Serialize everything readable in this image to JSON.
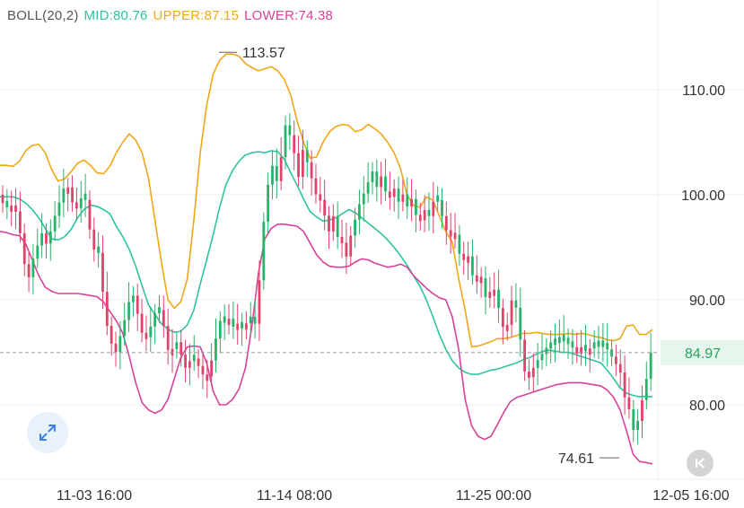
{
  "legend": {
    "title": "BOLL(20,2)",
    "mid": "MID:80.76",
    "upper": "UPPER:87.15",
    "lower": "LOWER:74.38"
  },
  "colors": {
    "mid": "#2ec4a0",
    "upper": "#f0a818",
    "lower": "#d8439a",
    "up_candle": "#27b36a",
    "down_candle": "#e0436a",
    "grid": "#eeeeee",
    "axis_text": "#333333",
    "price_tag_bg": "#e7f6ec",
    "price_tag_text": "#27a35e"
  },
  "icons": {
    "expand": "expand-diagonal-arrows-icon",
    "back": "skip-back-icon"
  },
  "chart_data": {
    "type": "candlestick",
    "indicator": "BOLL(20,2)",
    "ylim": [
      74,
      117
    ],
    "yticks": [
      "110.00",
      "100.00",
      "90.00",
      "80.00"
    ],
    "xlabels": [
      "11-03 16:00",
      "11-14 08:00",
      "11-25 00:00",
      "12-05 16:00"
    ],
    "current_price": "84.97",
    "annotations": {
      "high": "113.57",
      "low": "74.61"
    },
    "bands": {
      "upper": [
        102.8,
        102.8,
        102.7,
        103.2,
        104.2,
        104.7,
        104.8,
        104.0,
        102.4,
        101.3,
        101.5,
        102.2,
        103.0,
        103.3,
        102.8,
        102.1,
        102.0,
        102.7,
        104.0,
        105.0,
        105.8,
        105.2,
        104.0,
        101.5,
        97.5,
        93.5,
        90.0,
        89.2,
        89.8,
        92.0,
        97.5,
        104.0,
        108.5,
        111.5,
        112.8,
        113.4,
        113.4,
        113.2,
        112.5,
        112.1,
        111.8,
        112.0,
        112.2,
        111.8,
        111.0,
        109.5,
        107.0,
        105.0,
        103.5,
        103.6,
        105.0,
        106.0,
        106.5,
        106.7,
        106.6,
        106.0,
        106.2,
        106.7,
        106.3,
        105.8,
        105.0,
        104.0,
        102.5,
        100.0,
        99.0,
        98.8,
        99.8,
        99.5,
        98.0,
        96.5,
        95.5,
        92.0,
        89.0,
        85.5,
        85.6,
        85.8,
        86.0,
        86.3,
        86.3,
        86.4,
        86.6,
        86.8,
        86.8,
        86.9,
        86.8,
        86.7,
        86.7,
        86.7,
        86.8,
        86.7,
        86.8,
        86.7,
        86.5,
        86.4,
        86.2,
        86.1,
        86.3,
        87.5,
        87.6,
        86.7,
        86.7,
        87.15
      ],
      "mid": [
        99.8,
        99.8,
        99.8,
        99.6,
        99.2,
        98.6,
        97.8,
        96.8,
        95.8,
        95.7,
        96.0,
        96.7,
        97.8,
        98.6,
        99.0,
        98.9,
        98.6,
        98.2,
        97.0,
        96.0,
        94.8,
        93.2,
        91.3,
        89.5,
        88.6,
        87.7,
        87.2,
        86.9,
        87.0,
        87.6,
        89.0,
        91.5,
        93.8,
        96.2,
        98.8,
        101.0,
        102.3,
        103.2,
        103.8,
        104.0,
        104.1,
        104.0,
        104.2,
        104.1,
        103.4,
        102.1,
        100.9,
        99.6,
        98.4,
        97.9,
        97.5,
        97.6,
        97.8,
        98.2,
        98.6,
        98.3,
        97.8,
        97.3,
        96.8,
        96.3,
        95.7,
        95.0,
        94.2,
        93.3,
        92.3,
        91.3,
        90.0,
        88.4,
        86.7,
        85.3,
        84.2,
        83.5,
        83.1,
        82.9,
        82.9,
        83.1,
        83.3,
        83.4,
        83.6,
        83.8,
        84.0,
        84.3,
        84.5,
        84.8,
        85.1,
        85.2,
        85.1,
        85.0,
        85.0,
        84.8,
        84.6,
        84.4,
        84.2,
        84.0,
        83.3,
        82.5,
        81.6,
        81.1,
        80.9,
        80.76,
        80.8,
        80.76
      ],
      "lower": [
        96.5,
        96.4,
        96.2,
        96.1,
        95.3,
        93.8,
        92.3,
        91.2,
        90.8,
        90.6,
        90.6,
        90.6,
        90.6,
        90.5,
        90.4,
        90.3,
        89.8,
        88.9,
        88.0,
        86.8,
        84.6,
        82.1,
        80.2,
        79.5,
        79.2,
        79.5,
        80.5,
        82.5,
        84.5,
        85.5,
        85.6,
        85.5,
        84.0,
        81.3,
        80.0,
        80.0,
        80.5,
        81.5,
        83.5,
        87.5,
        92.5,
        95.8,
        96.8,
        97.2,
        97.2,
        97.1,
        97.0,
        96.5,
        95.4,
        94.3,
        93.6,
        93.2,
        93.1,
        93.1,
        93.2,
        93.6,
        93.9,
        93.8,
        93.5,
        93.3,
        93.1,
        93.2,
        93.4,
        93.1,
        92.3,
        91.7,
        91.1,
        90.6,
        90.2,
        90.0,
        88.4,
        85.3,
        80.5,
        78.0,
        77.0,
        76.7,
        77.0,
        78.1,
        79.3,
        80.3,
        80.7,
        80.9,
        81.1,
        81.3,
        81.5,
        81.7,
        81.9,
        82.0,
        82.1,
        82.1,
        82.1,
        82.0,
        81.9,
        81.8,
        81.4,
        80.7,
        79.5,
        77.5,
        75.3,
        74.6,
        74.5,
        74.38
      ]
    },
    "candles": {
      "count": 150,
      "direction": [
        "down",
        "up",
        "down",
        "down",
        "down",
        "down",
        "down",
        "up",
        "up",
        "up",
        "down",
        "up",
        "up",
        "up",
        "up",
        "down",
        "down",
        "down",
        "up",
        "up",
        "down",
        "down",
        "up",
        "down",
        "down",
        "down",
        "down",
        "up",
        "up",
        "up",
        "up",
        "down",
        "down",
        "down",
        "up",
        "up",
        "up",
        "down",
        "down",
        "down",
        "up",
        "down",
        "down",
        "down",
        "up",
        "down",
        "down",
        "down",
        "down",
        "up",
        "up",
        "up",
        "down",
        "up",
        "down",
        "up",
        "down",
        "up",
        "up",
        "down",
        "up",
        "up",
        "up",
        "up",
        "down",
        "up",
        "up",
        "down",
        "down",
        "down",
        "up",
        "down",
        "down",
        "down",
        "down",
        "down",
        "down",
        "up",
        "down",
        "down",
        "down",
        "up",
        "up",
        "up",
        "up",
        "up",
        "up",
        "down",
        "up",
        "down",
        "down",
        "up",
        "down",
        "up",
        "down",
        "up",
        "down",
        "down",
        "up",
        "down",
        "up",
        "up",
        "down",
        "down",
        "down",
        "up",
        "down",
        "down",
        "up",
        "down",
        "down",
        "up",
        "down",
        "down",
        "up",
        "down",
        "down",
        "down",
        "up",
        "up",
        "down",
        "down",
        "down",
        "up",
        "up",
        "up",
        "up",
        "up",
        "up",
        "up",
        "up",
        "up",
        "down",
        "down",
        "up",
        "down",
        "up",
        "up",
        "up",
        "up",
        "up",
        "down",
        "down",
        "down",
        "down",
        "up",
        "up",
        "down",
        "up",
        "up"
      ],
      "close_path": [
        99.2,
        98.8,
        99.0,
        98.5,
        96.5,
        93.5,
        92.0,
        93.8,
        95.0,
        96.5,
        95.2,
        96.3,
        97.8,
        99.0,
        100.5,
        101.0,
        99.5,
        98.5,
        99.5,
        100.2,
        97.5,
        94.5,
        95.5,
        92.0,
        88.0,
        86.5,
        84.5,
        86.0,
        87.5,
        89.0,
        91.0,
        89.5,
        87.5,
        86.0,
        87.0,
        88.0,
        89.5,
        88.5,
        86.5,
        84.0,
        86.5,
        85.5,
        84.2,
        83.0,
        85.0,
        84.0,
        83.5,
        82.5,
        82.8,
        85.0,
        87.0,
        88.5,
        87.5,
        88.5,
        87.0,
        88.0,
        87.0,
        88.0,
        88.5,
        87.5,
        93.0,
        98.5,
        101.5,
        103.0,
        101.0,
        104.0,
        107.0,
        105.5,
        103.8,
        101.5,
        104.5,
        103.0,
        101.5,
        100.0,
        99.5,
        98.0,
        96.5,
        98.0,
        96.0,
        95.5,
        94.0,
        96.0,
        97.5,
        99.0,
        100.0,
        101.0,
        102.5,
        100.5,
        102.0,
        100.5,
        99.5,
        101.0,
        99.0,
        100.5,
        98.5,
        100.0,
        98.5,
        97.0,
        99.0,
        97.5,
        99.0,
        100.0,
        98.5,
        97.0,
        96.0,
        97.0,
        95.0,
        93.5,
        95.0,
        93.0,
        91.5,
        93.0,
        91.0,
        89.5,
        92.0,
        90.0,
        88.5,
        86.5,
        88.5,
        91.0,
        88.0,
        85.0,
        82.0,
        83.0,
        83.8,
        84.5,
        85.0,
        85.5,
        85.8,
        85.9,
        86.1,
        86.3,
        85.6,
        85.4,
        85.5,
        85.0,
        85.2,
        85.4,
        85.6,
        85.5,
        85.8,
        85.2,
        84.5,
        83.8,
        83.0,
        80.5,
        79.5,
        77.5,
        78.5,
        80.5,
        82.5,
        84.97
      ]
    }
  }
}
